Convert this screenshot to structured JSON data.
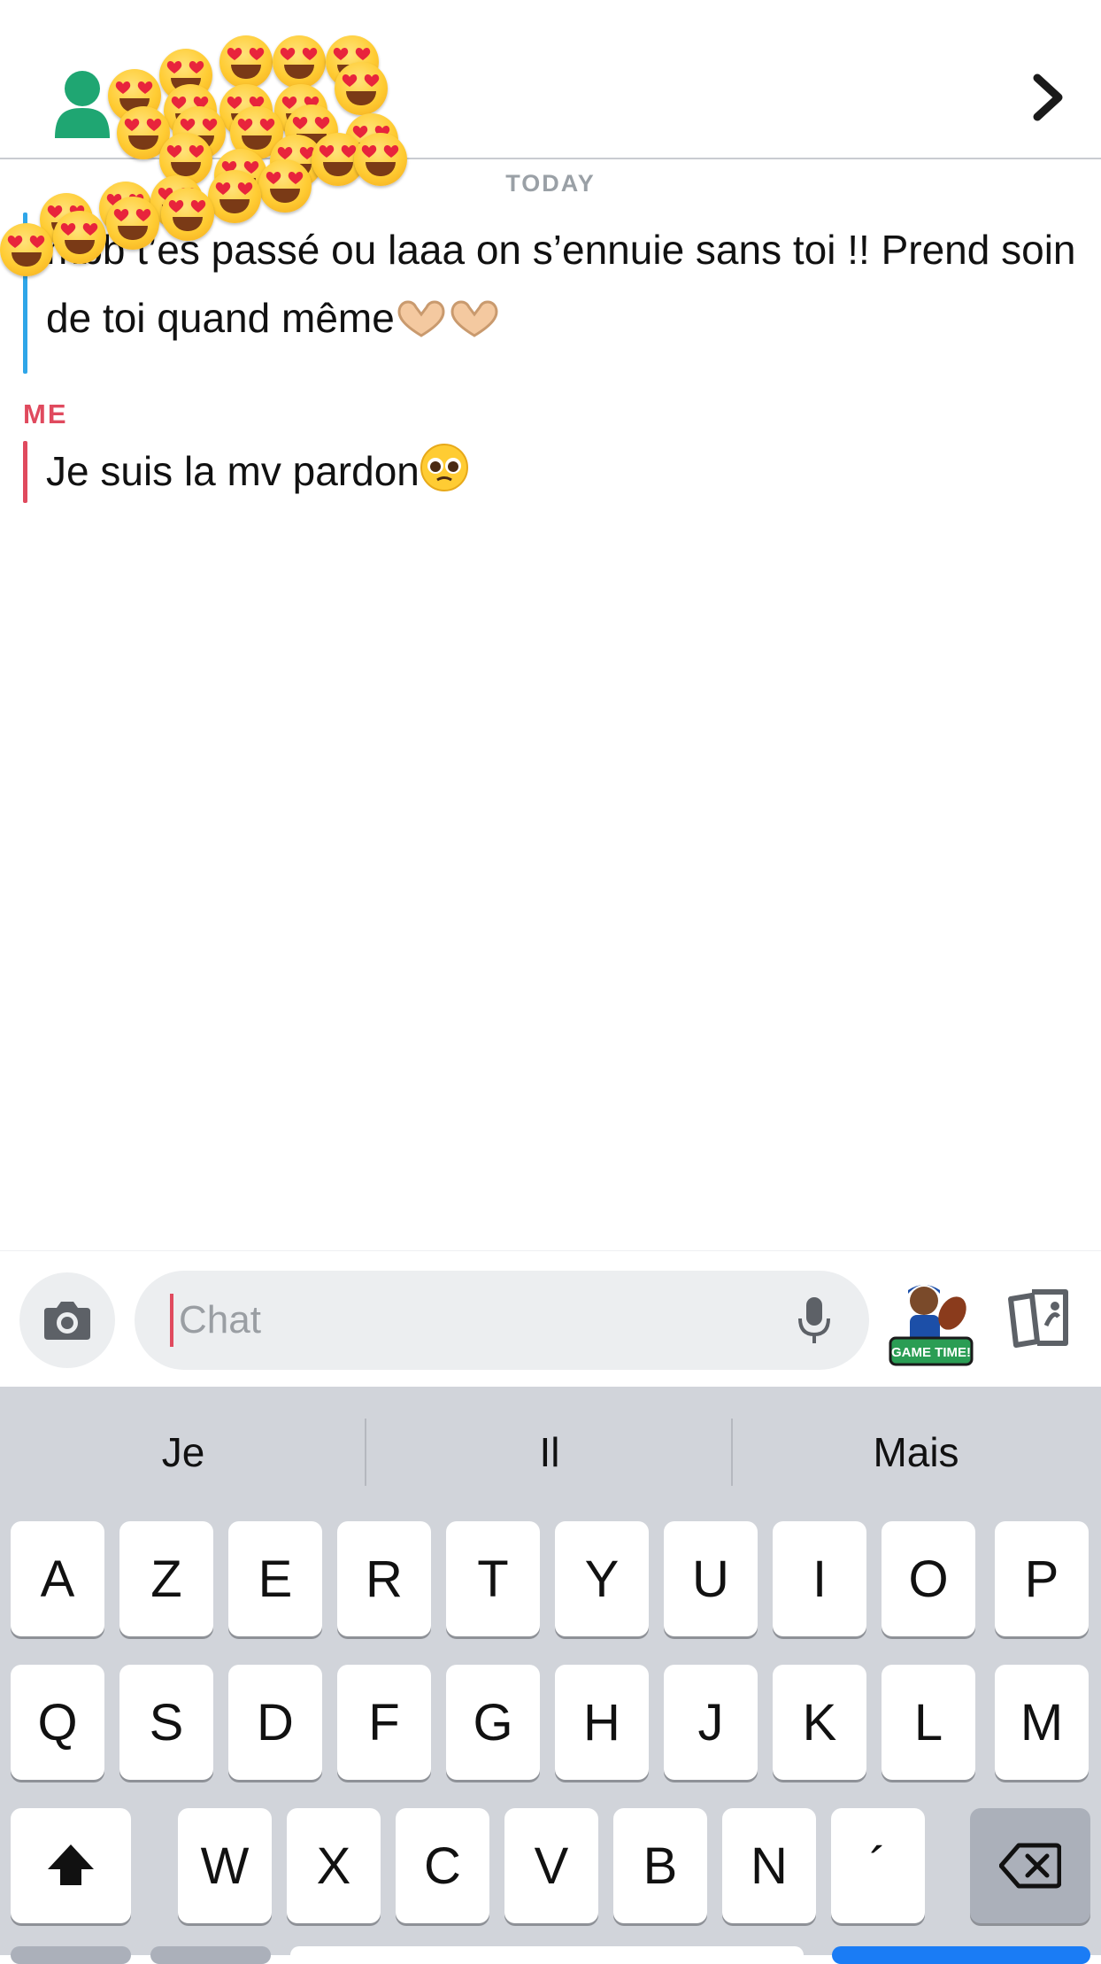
{
  "header": {
    "avatar_icon": "user-silhouette-icon",
    "chevron_icon": "chevron-right-icon",
    "sticker_overlay": "heart-eyes-emoji-cluster",
    "colors": {
      "avatar": "#1fa672",
      "divider": "#c9ccd1"
    }
  },
  "conversation": {
    "date_label": "TODAY",
    "messages": [
      {
        "sender": "",
        "text": "mbb t’es passé ou laaa on s’ennuie sans toi !! Prend soin de toi quand même",
        "trailing_emoji": "heart-hands-emoji heart-hands-emoji",
        "bar_color": "#2fa6e8"
      },
      {
        "sender": "ME",
        "text": "Je suis la mv pardon",
        "trailing_emoji": "pleading-face-emoji",
        "bar_color": "#e04a5e"
      }
    ]
  },
  "composer": {
    "camera_icon": "camera-icon",
    "placeholder": "Chat",
    "value": "",
    "mic_icon": "microphone-icon",
    "bitmoji_text": "GAME TIME!",
    "sticker_icon": "sticker-cards-icon"
  },
  "keyboard": {
    "suggestions": [
      "Je",
      "Il",
      "Mais"
    ],
    "row1": [
      "A",
      "Z",
      "E",
      "R",
      "T",
      "Y",
      "U",
      "I",
      "O",
      "P"
    ],
    "row2": [
      "Q",
      "S",
      "D",
      "F",
      "G",
      "H",
      "J",
      "K",
      "L",
      "M"
    ],
    "row3": [
      "W",
      "X",
      "C",
      "V",
      "B",
      "N",
      "´"
    ],
    "shift_icon": "shift-arrow-icon",
    "backspace_icon": "backspace-icon"
  }
}
